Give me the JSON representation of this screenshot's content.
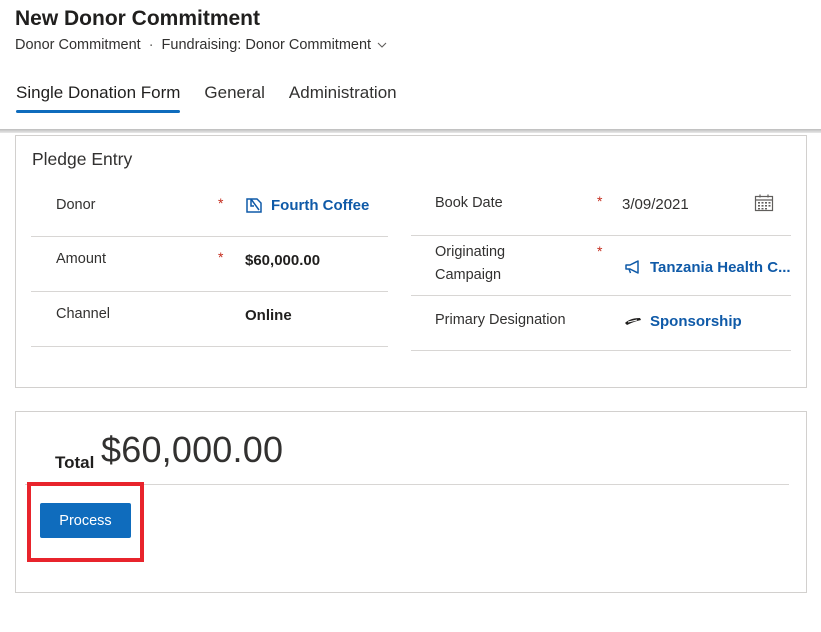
{
  "header": {
    "title": "New Donor Commitment",
    "entity": "Donor Commitment",
    "separator": "·",
    "form_name": "Fundraising: Donor Commitment"
  },
  "tabs": [
    {
      "label": "Single Donation Form",
      "active": true
    },
    {
      "label": "General",
      "active": false
    },
    {
      "label": "Administration",
      "active": false
    }
  ],
  "pledge": {
    "section_title": "Pledge Entry",
    "donor": {
      "label": "Donor",
      "required": "*",
      "value": "Fourth Coffee",
      "icon": "account-icon"
    },
    "amount": {
      "label": "Amount",
      "required": "*",
      "value": "$60,000.00"
    },
    "channel": {
      "label": "Channel",
      "value": "Online"
    },
    "book_date": {
      "label": "Book Date",
      "required": "*",
      "value": "3/09/2021",
      "icon": "calendar-icon"
    },
    "campaign": {
      "label_line1": "Originating",
      "label_line2": "Campaign",
      "required": "*",
      "value": "Tanzania Health C...",
      "icon": "megaphone-icon"
    },
    "designation": {
      "label": "Primary Designation",
      "value": "Sponsorship",
      "icon": "designation-icon"
    }
  },
  "summary": {
    "total_label": "Total",
    "total_value": "$60,000.00",
    "process_label": "Process"
  },
  "colors": {
    "accent": "#0f6cbd",
    "link": "#0f5aa8",
    "required": "#c42b1c",
    "highlight": "#e8242c"
  }
}
